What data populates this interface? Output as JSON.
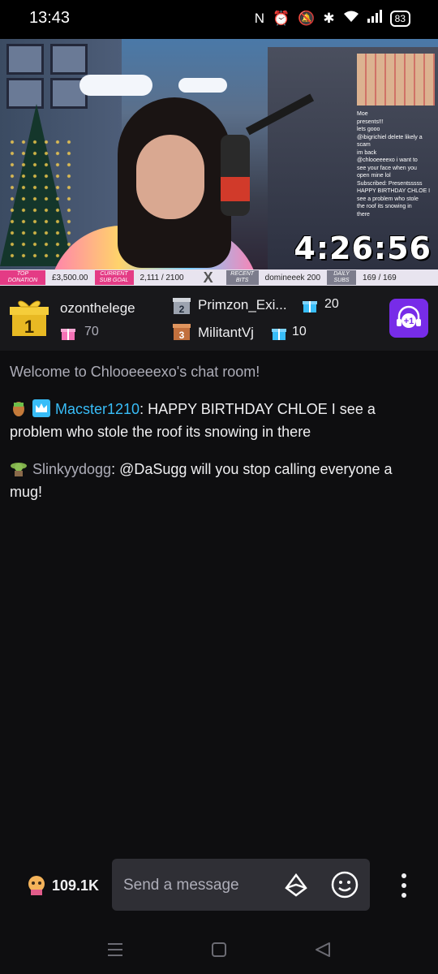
{
  "status_bar": {
    "time": "13:43",
    "battery": "83"
  },
  "stream_overlay": {
    "timer": "4:26:56",
    "ticker": {
      "top_donation_label": "TOP DONATION",
      "top_donation_value": "£3,500.00",
      "sub_goal_label": "CURRENT SUB GOAL",
      "sub_goal_value": "2,111 / 2100",
      "recent_bits_label": "RECENT BITS",
      "recent_bits_value": "domineeek 200",
      "daily_subs_label": "DAILY SUBS",
      "daily_subs_value": "169 / 169"
    },
    "chat_lines": [
      "Moe",
      "presents!!!",
      "lets gooo",
      "@ibigrichiel delete likely a",
      "scam",
      "im back",
      "@chlooeeeexo i want to",
      "see your face when you",
      "open mine lol",
      "Subscribed: Presentsssss",
      "HAPPY BIRTHDAY CHLOE I",
      "see a problem who stole",
      "the roof its snowing in",
      "there"
    ]
  },
  "leaderboard": {
    "first": {
      "rank": "1",
      "name": "ozonthelege",
      "count": "70"
    },
    "second": {
      "rank": "2",
      "name": "Primzon_Exi...",
      "count": "20"
    },
    "third": {
      "rank": "3",
      "name": "MilitantVj",
      "count": "10"
    },
    "plus_one_label": "+1"
  },
  "chat": {
    "welcome": "Welcome to Chlooeeeexo's chat room!",
    "messages": [
      {
        "user": "Macster1210",
        "text": ": HAPPY BIRTHDAY CHLOE I see a problem who stole the roof its snowing in there"
      },
      {
        "user": "Slinkyydogg",
        "text": ": @DaSugg will you stop calling everyone a mug!"
      }
    ]
  },
  "input_bar": {
    "viewer_count": "109.1K",
    "placeholder": "Send a message"
  },
  "colors": {
    "background": "#0e0e10",
    "panel": "#18181b",
    "accent_purple": "#772ce8",
    "username_blue": "#38bdf8",
    "gold": "#e8b923"
  }
}
